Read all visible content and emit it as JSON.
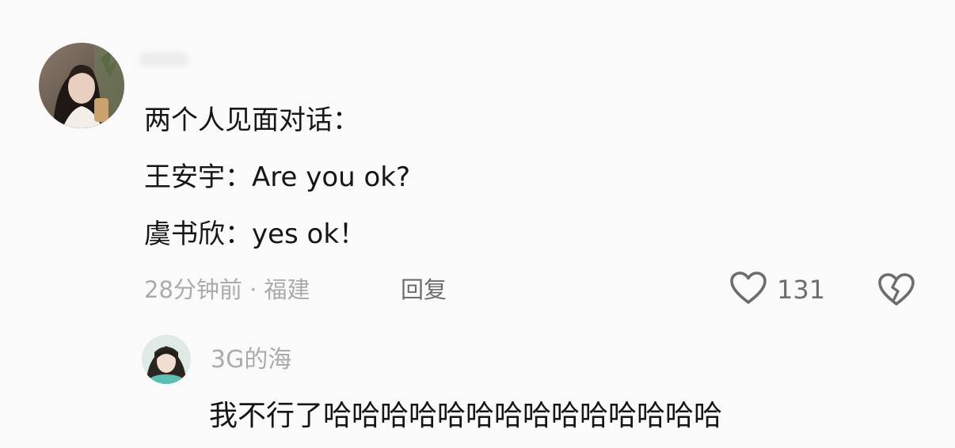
{
  "comment": {
    "lines": [
      "两个人见面对话：",
      "王安宇：Are you ok?",
      "虞书欣：yes ok！"
    ],
    "meta": "28分钟前 · 福建",
    "reply_label": "回复",
    "like_count": "131",
    "icons": {
      "like": "heart-outline-icon",
      "dislike": "broken-heart-icon"
    }
  },
  "reply": {
    "username": "3G的海",
    "text": "我不行了哈哈哈哈哈哈哈哈哈哈哈哈哈哈"
  },
  "colors": {
    "background": "#fafafa",
    "text": "#161616",
    "muted": "#ababab",
    "secondary": "#6d6d6d"
  }
}
